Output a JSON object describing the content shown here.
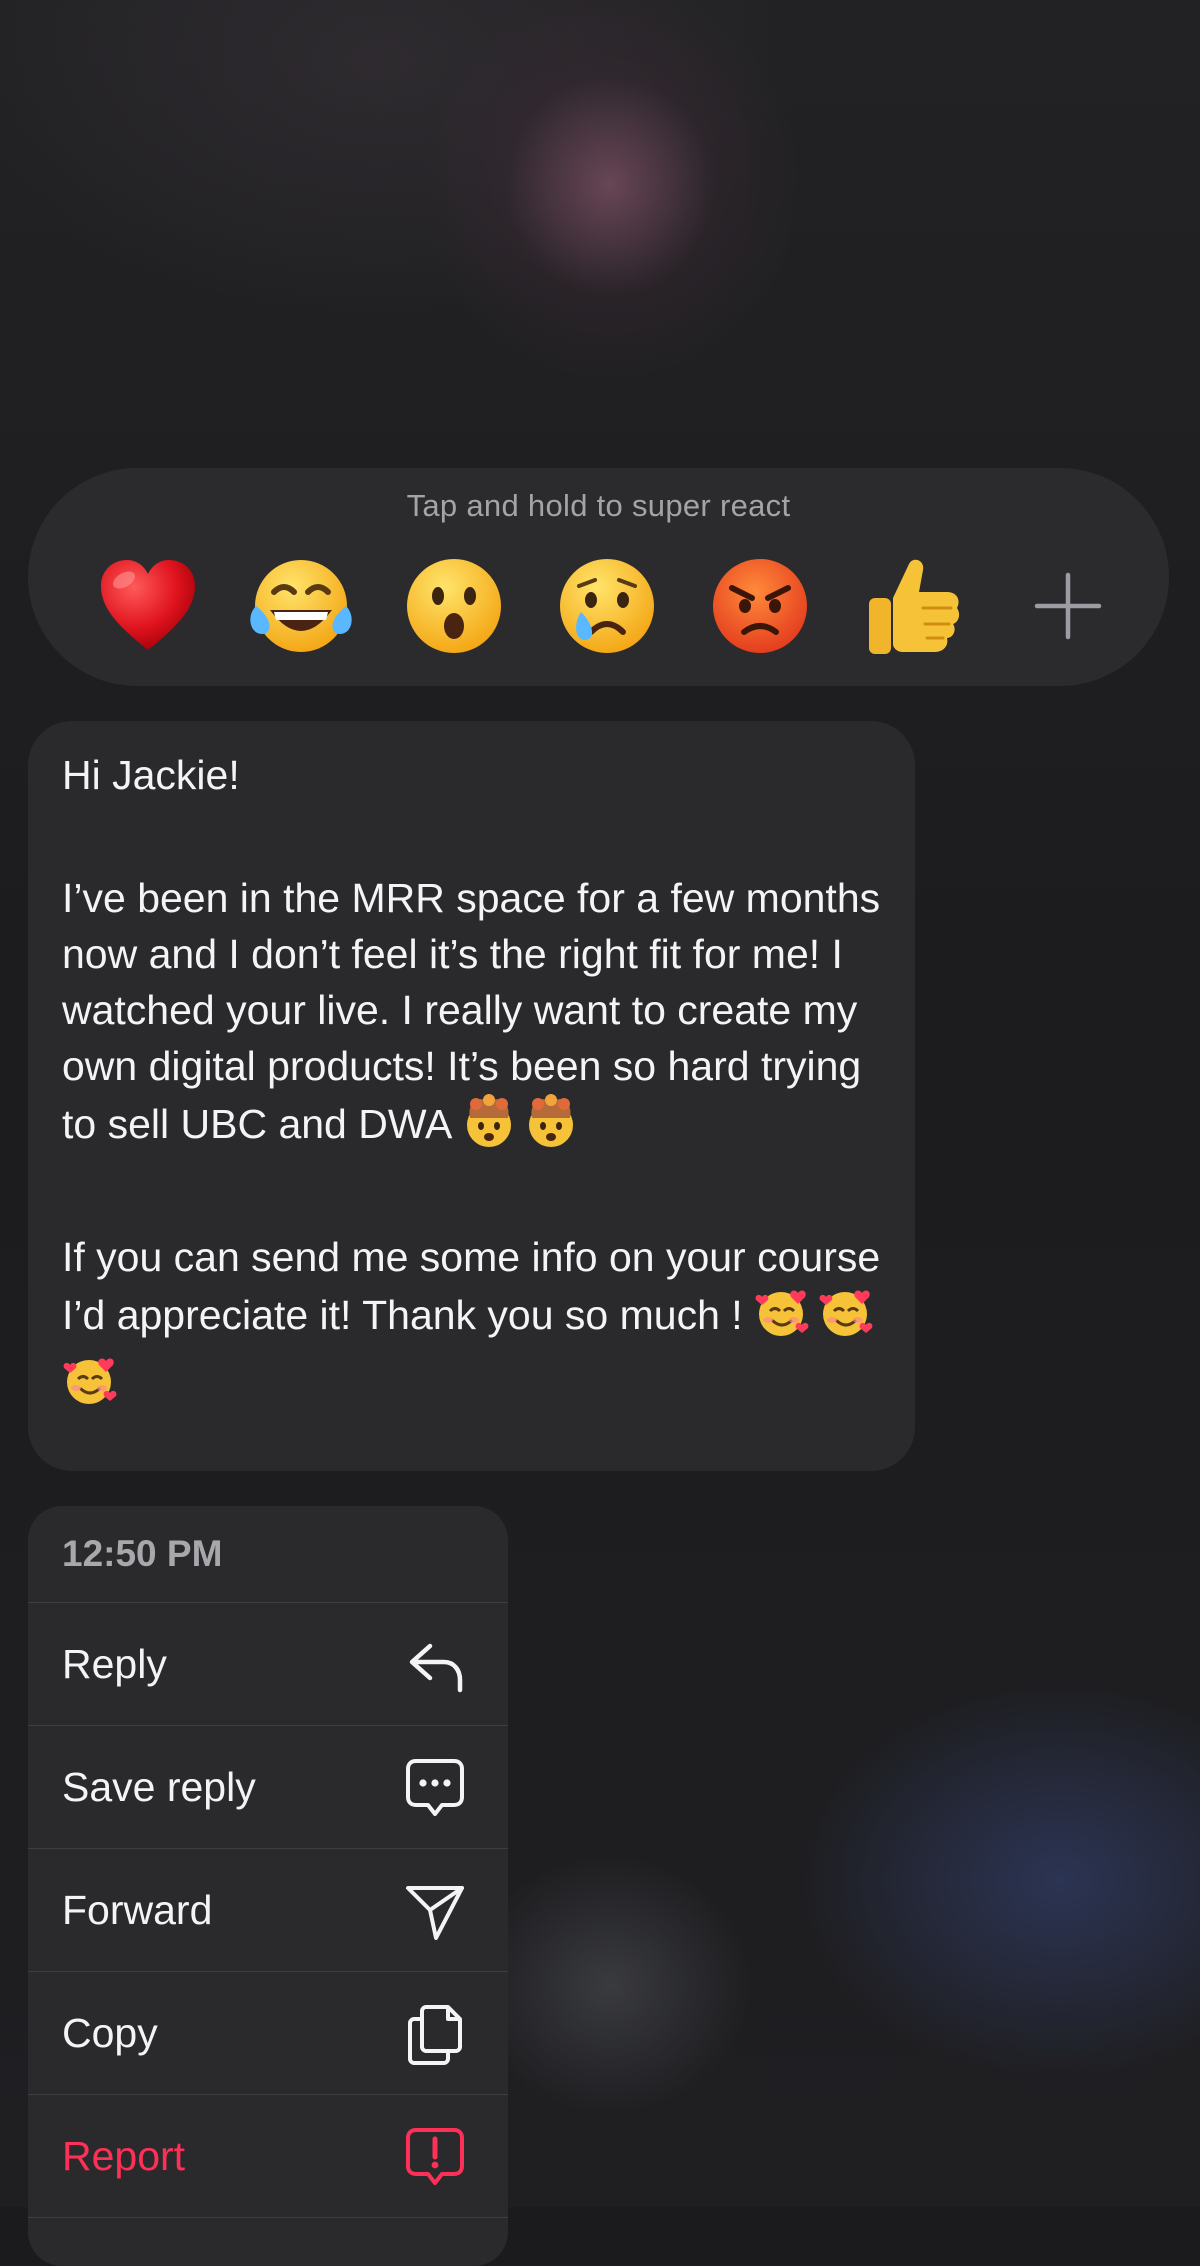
{
  "reaction_bar": {
    "hint": "Tap and hold to super react",
    "reactions": [
      {
        "name": "heart",
        "emoji": "❤️"
      },
      {
        "name": "laughing",
        "emoji": "😂"
      },
      {
        "name": "surprised",
        "emoji": "😮"
      },
      {
        "name": "sad",
        "emoji": "😢"
      },
      {
        "name": "angry",
        "emoji": "😡"
      },
      {
        "name": "thumbs-up",
        "emoji": "👍"
      }
    ],
    "more_icon": "plus-icon"
  },
  "message": {
    "greeting": "Hi Jackie!",
    "body1": "I’ve been in the MRR space for a few months now and I don’t feel it’s the right fit for me! I watched your live. I really want to create my own digital products! It’s been so hard trying to sell UBC and DWA",
    "body1_emojis": [
      "🤯",
      "🤯"
    ],
    "body2": "If you can send me some info on your course I’d appreciate it! Thank you so much !",
    "body2_emojis": [
      "🥰",
      "🥰",
      "🥰"
    ]
  },
  "menu": {
    "timestamp": "12:50 PM",
    "items": [
      {
        "label": "Reply",
        "icon": "reply-arrow-icon"
      },
      {
        "label": "Save reply",
        "icon": "chat-bubble-dots-icon"
      },
      {
        "label": "Forward",
        "icon": "paper-plane-icon"
      },
      {
        "label": "Copy",
        "icon": "copy-icon"
      },
      {
        "label": "Report",
        "icon": "report-exclamation-icon",
        "color": "#ff3057"
      }
    ]
  },
  "colors": {
    "background": "#1c1c1e",
    "surface": "#2a2a2d",
    "hint_text": "#a3a3a8",
    "danger": "#ff3057"
  }
}
